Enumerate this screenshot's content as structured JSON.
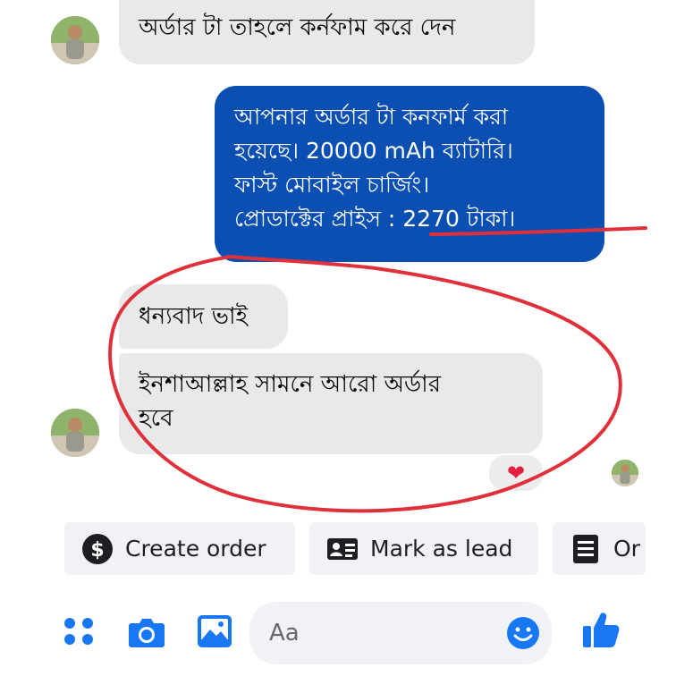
{
  "messages": [
    {
      "from": "customer",
      "text": "অর্ডার টা তাহলে কর্নফাম করে দেন"
    },
    {
      "from": "page",
      "lines": [
        "আপনার অর্ডার টা কনফার্ম করা",
        "হয়েছে। 20000 mAh ব্যাটারি।",
        "ফাস্ট মোবাইল চার্জিং।",
        "প্রোডাক্টের প্রাইস : 2270 টাকা।"
      ]
    },
    {
      "from": "customer",
      "text": "ধন্যবাদ ভাই"
    },
    {
      "from": "customer",
      "lines": [
        "ইনশাআল্লাহ সামনে আরো অর্ডার",
        "হবে"
      ]
    }
  ],
  "reaction": {
    "emoji": "❤"
  },
  "quick_actions": [
    {
      "label": "Create order",
      "icon": "dollar-icon"
    },
    {
      "label": "Mark as lead",
      "icon": "contact-card-icon"
    },
    {
      "label": "Or",
      "icon": "list-document-icon"
    }
  ],
  "composer": {
    "placeholder": "Aa"
  },
  "colors": {
    "outgoing_bubble": "#0b4fb3",
    "incoming_bubble": "#e9e9eb",
    "accent": "#1877f2",
    "annotation": "#e0313b"
  },
  "icons": [
    "menu-dots-icon",
    "camera-icon",
    "gallery-icon",
    "emoji-icon",
    "thumbs-up-icon"
  ]
}
